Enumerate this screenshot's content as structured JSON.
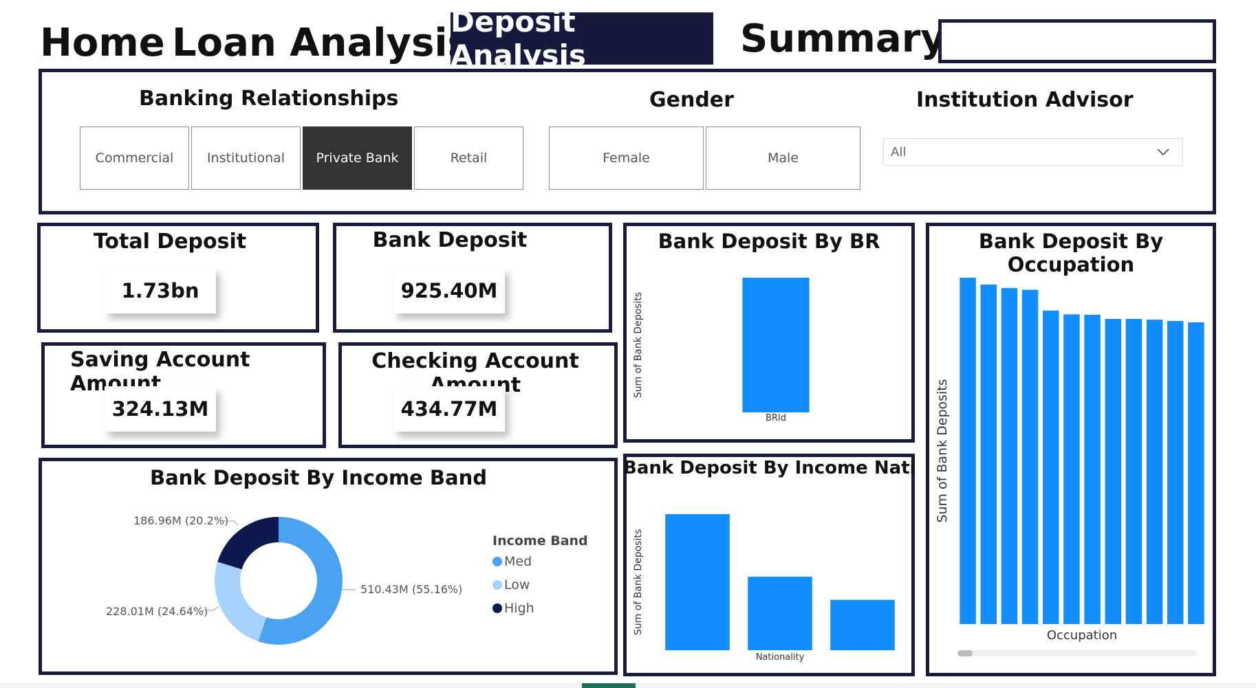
{
  "nav": {
    "home": "Home",
    "loan": "Loan Analysis",
    "deposit": "Deposit Analysis",
    "summary": "Summary"
  },
  "filters": {
    "banking_title": "Banking Relationships",
    "banking_options": [
      "Commercial",
      "Institutional",
      "Private Bank",
      "Retail"
    ],
    "banking_selected": "Private Bank",
    "gender_title": "Gender",
    "gender_options": [
      "Female",
      "Male"
    ],
    "advisor_title": "Institution Advisor",
    "advisor_value": "All"
  },
  "kpis": {
    "total_deposit": {
      "title": "Total Deposit",
      "value": "1.73bn"
    },
    "bank_deposit": {
      "title": "Bank Deposit",
      "value": "925.40M"
    },
    "saving_amount": {
      "title": "Saving Account Amount",
      "value": "324.13M"
    },
    "checking_amount": {
      "title": "Checking Account Amount",
      "value": "434.77M"
    }
  },
  "colors": {
    "bar": "#118dff",
    "med": "#4aa3f0",
    "low": "#a6d1fb",
    "high": "#0d1a4f",
    "frame": "#1a1a3a",
    "nav_active": "#17193f"
  },
  "chart_data": [
    {
      "id": "br",
      "type": "bar",
      "title": "Bank Deposit By BR",
      "xlabel": "BRId",
      "ylabel": "Sum of Bank Deposits",
      "categories": [
        ""
      ],
      "values": [
        1
      ]
    },
    {
      "id": "nationality",
      "type": "bar",
      "title": "Bank Deposit By Income Nationality",
      "xlabel": "Nationality",
      "ylabel": "Sum of Bank Deposits",
      "categories": [
        "",
        "",
        ""
      ],
      "values": [
        1.0,
        0.54,
        0.37
      ]
    },
    {
      "id": "occupation",
      "type": "bar",
      "title": "Bank Deposit By Occupation",
      "xlabel": "Occupation",
      "ylabel": "Sum of Bank Deposits",
      "categories": [
        "",
        "",
        "",
        "",
        "",
        "",
        "",
        "",
        "",
        "",
        "",
        ""
      ],
      "values": [
        1.0,
        0.98,
        0.97,
        0.965,
        0.905,
        0.894,
        0.893,
        0.881,
        0.881,
        0.879,
        0.875,
        0.871
      ]
    },
    {
      "id": "income_band",
      "type": "pie",
      "title": "Bank Deposit By Income Band",
      "legend_title": "Income Band",
      "slices": [
        {
          "name": "Med",
          "value": 510.43,
          "label": "510.43M (55.16%)"
        },
        {
          "name": "Low",
          "value": 228.01,
          "label": "228.01M (24.64%)"
        },
        {
          "name": "High",
          "value": 186.96,
          "label": "186.96M (20.2%)"
        }
      ]
    }
  ]
}
